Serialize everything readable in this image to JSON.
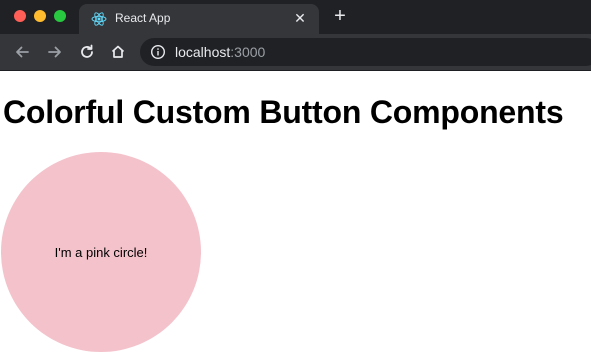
{
  "browser": {
    "tab": {
      "title": "React App",
      "favicon": "react-logo-icon",
      "close_icon": "close-icon"
    },
    "new_tab_icon": "plus-icon",
    "toolbar": {
      "back_icon": "back-arrow-icon",
      "forward_icon": "forward-arrow-icon",
      "reload_icon": "reload-icon",
      "home_icon": "home-icon"
    },
    "address": {
      "host": "localhost",
      "port": ":3000",
      "info_icon": "info-icon"
    },
    "colors": {
      "titlebar": "#202124",
      "toolbar": "#35363a",
      "omnibox": "#202124"
    }
  },
  "page": {
    "heading": "Colorful Custom Button Components",
    "button": {
      "label": "I'm a pink circle!",
      "color": "#f4c2cb"
    }
  }
}
